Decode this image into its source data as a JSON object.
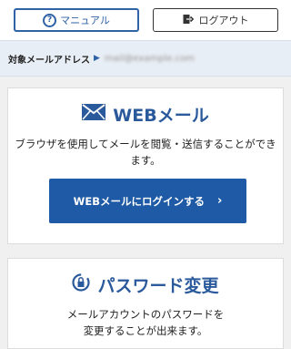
{
  "header": {
    "manual_label": "マニュアル",
    "logout_label": "ログアウト"
  },
  "target": {
    "label": "対象メールアドレス",
    "address": "mail@example.com"
  },
  "webmail": {
    "title": "WEBメール",
    "description": "ブラウザを使用してメールを閲覧・送信することができます。",
    "login_button": "WEBメールにログインする",
    "chevron": "›"
  },
  "password": {
    "title": "パスワード変更",
    "description": "メールアカウントのパスワードを変更することが出来ます。"
  },
  "colors": {
    "accent": "#1e5aa5",
    "title": "#2a5a9c"
  }
}
